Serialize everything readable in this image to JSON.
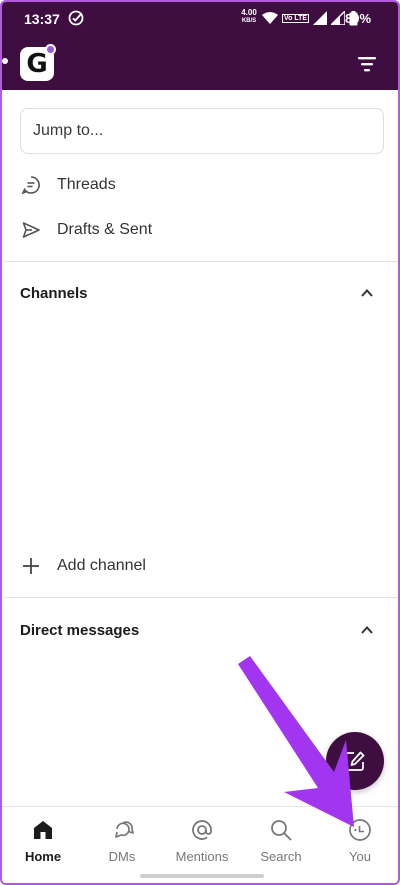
{
  "status_bar": {
    "time": "13:37",
    "net_speed_value": "4.00",
    "net_speed_unit": "KB/S",
    "lte_label": "Vo LTE",
    "battery": "89%"
  },
  "header": {
    "workspace_letter": "G",
    "accent_color": "#3f0e40"
  },
  "search": {
    "placeholder": "Jump to..."
  },
  "menu": {
    "threads": "Threads",
    "drafts": "Drafts & Sent"
  },
  "channels": {
    "title": "Channels",
    "add_label": "Add channel"
  },
  "direct_messages": {
    "title": "Direct messages"
  },
  "bottom_nav": {
    "items": [
      {
        "label": "Home",
        "icon": "home-icon",
        "active": true
      },
      {
        "label": "DMs",
        "icon": "dms-icon"
      },
      {
        "label": "Mentions",
        "icon": "at-icon"
      },
      {
        "label": "Search",
        "icon": "search-icon"
      },
      {
        "label": "You",
        "icon": "you-icon"
      }
    ]
  },
  "annotation": {
    "arrow_color": "#a236f0"
  }
}
